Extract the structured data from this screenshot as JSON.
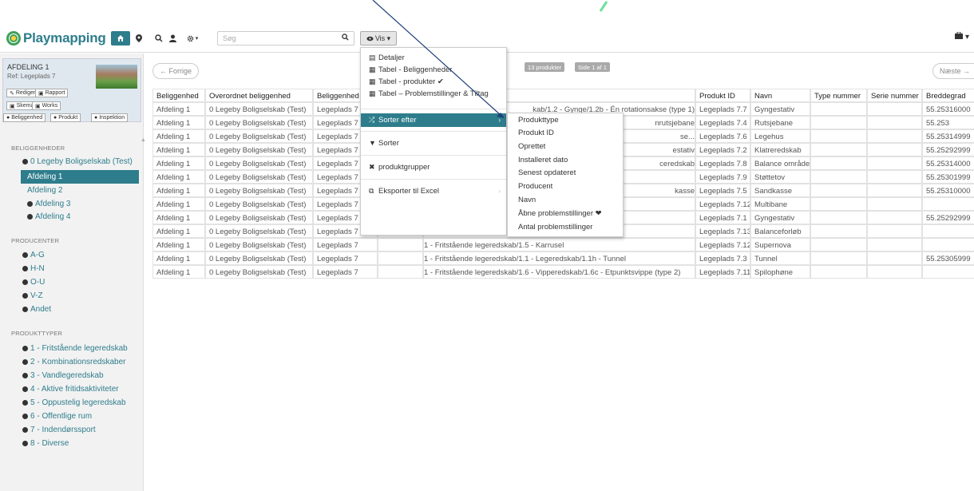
{
  "app": {
    "logo_text": "Playmapping",
    "search_placeholder": "Søg",
    "vis_label": "Vis ▾",
    "user_icon_label": "▾"
  },
  "card": {
    "title": "AFDELING 1",
    "subtitle": "Ref: Legeplads 7",
    "buttons": [
      "Rediger",
      "Rapport",
      "Skema",
      "Works"
    ],
    "tabs": [
      "Beliggenhed",
      "Produkt",
      "Inspektion"
    ]
  },
  "sidebar": {
    "beliggenheder_heading": "BELIGGENHEDER",
    "beliggenheder": [
      "0 Legeby Boligselskab (Test)",
      "Afdeling 1",
      "Afdeling 2",
      "Afdeling 3",
      "Afdeling 4"
    ],
    "producenter_heading": "PRODUCENTER",
    "producenter": [
      "A-G",
      "H-N",
      "O-U",
      "V-Z",
      "Andet"
    ],
    "produkttyper_heading": "PRODUKTTYPER",
    "produkttyper": [
      "1 - Fritstående legeredskab",
      "2 - Kombinationsredskaber",
      "3 - Vandlegeredskab",
      "4 - Aktive fritidsaktiviteter",
      "5 - Oppustelig legeredskab",
      "6 - Offentlige rum",
      "7 - Indendørssport",
      "8 - Diverse"
    ]
  },
  "pager": {
    "prev": "← Forrige",
    "next": "Næste →",
    "count_badge": "13 produkter",
    "page_badge": "Side 1 af 1"
  },
  "table": {
    "headers": [
      "Beliggenhed",
      "Overordnet beliggenhed",
      "Beliggenhed",
      "",
      "",
      "Produkt ID",
      "Navn",
      "Type nummer",
      "Serie nummer",
      "Breddegrad"
    ],
    "rows": [
      [
        "Afdeling 1",
        "0 Legeby Boligselskab (Test)",
        "Legeplads 7",
        "",
        "kab/1.2 - Gynge/1.2b - Én rotationsakse (type 1)",
        "Legeplads 7.7",
        "Gyngestativ",
        "",
        "",
        "55.25316000"
      ],
      [
        "Afdeling 1",
        "0 Legeby Boligselskab (Test)",
        "Legeplads 7",
        "",
        "nrutsjebane",
        "Legeplads 7.4",
        "Rutsjebane",
        "",
        "",
        "55.253"
      ],
      [
        "Afdeling 1",
        "0 Legeby Boligselskab (Test)",
        "Legeplads 7",
        "",
        "se...",
        "Legeplads 7.6",
        "Legehus",
        "",
        "",
        "55.25314999"
      ],
      [
        "Afdeling 1",
        "0 Legeby Boligselskab (Test)",
        "Legeplads 7",
        "",
        "estativ",
        "Legeplads 7.2",
        "Klatreredskab",
        "",
        "",
        "55.25292999"
      ],
      [
        "Afdeling 1",
        "0 Legeby Boligselskab (Test)",
        "Legeplads 7",
        "",
        "ceredskab",
        "Legeplads 7.8",
        "Balance område",
        "",
        "",
        "55.25314000"
      ],
      [
        "Afdeling 1",
        "0 Legeby Boligselskab (Test)",
        "Legeplads 7",
        "",
        "",
        "Legeplads 7.9",
        "Støttetov",
        "",
        "",
        "55.25301999"
      ],
      [
        "Afdeling 1",
        "0 Legeby Boligselskab (Test)",
        "Legeplads 7",
        "",
        "kasse",
        "Legeplads 7.5",
        "Sandkasse",
        "",
        "",
        "55.25310000"
      ],
      [
        "Afdeling 1",
        "0 Legeby Boligselskab (Test)",
        "Legeplads 7",
        "",
        "6 - Offentlige rum/6.2 -",
        "Legeplads 7.12",
        "Multibane",
        "",
        "",
        ""
      ],
      [
        "Afdeling 1",
        "0 Legeby Boligselskab (Test)",
        "Legeplads 7",
        "",
        "1 - Fritstående legereds          ısakse (type 1)",
        "Legeplads 7.1",
        "Gyngestativ",
        "",
        "",
        "55.25292999"
      ],
      [
        "Afdeling 1",
        "0 Legeby Boligselskab (Test)",
        "Legeplads 7",
        "",
        "2 - Kombinationsredskaber/2.5 - Redskabsgruppe",
        "Legeplads 7.13",
        "Balanceforløb",
        "",
        "",
        ""
      ],
      [
        "Afdeling 1",
        "0 Legeby Boligselskab (Test)",
        "Legeplads 7",
        "",
        "1 - Fritstående legeredskab/1.5 - Karrusel",
        "Legeplads 7.12",
        "Supernova",
        "",
        "",
        ""
      ],
      [
        "Afdeling 1",
        "0 Legeby Boligselskab (Test)",
        "Legeplads 7",
        "",
        "1 - Fritstående legeredskab/1.1 - Legeredskab/1.1h - Tunnel",
        "Legeplads 7.3",
        "Tunnel",
        "",
        "",
        "55.25305999"
      ],
      [
        "Afdeling 1",
        "0 Legeby Boligselskab (Test)",
        "Legeplads 7",
        "",
        "1 - Fritstående legeredskab/1.6 - Vipperedskab/1.6c - Etpunktsvippe (type 2)",
        "Legeplads 7.11",
        "Spilophøne",
        "",
        "",
        ""
      ]
    ]
  },
  "vis_menu": {
    "items": [
      "Detaljer",
      "Tabel - Beliggenheder",
      "Tabel - produkter ✔",
      "Tabel – Problemstillinger & Tiltag",
      "Sorter efter",
      "Sorter",
      "produktgrupper",
      "Eksporter til Excel"
    ]
  },
  "sort_menu": {
    "items": [
      "Produkttype",
      "Produkt ID",
      "Oprettet",
      "Installeret dato",
      "Senest opdateret",
      "Producent",
      "Navn",
      "Åbne problemstillinger ❤",
      "Antal problemstillinger"
    ]
  }
}
